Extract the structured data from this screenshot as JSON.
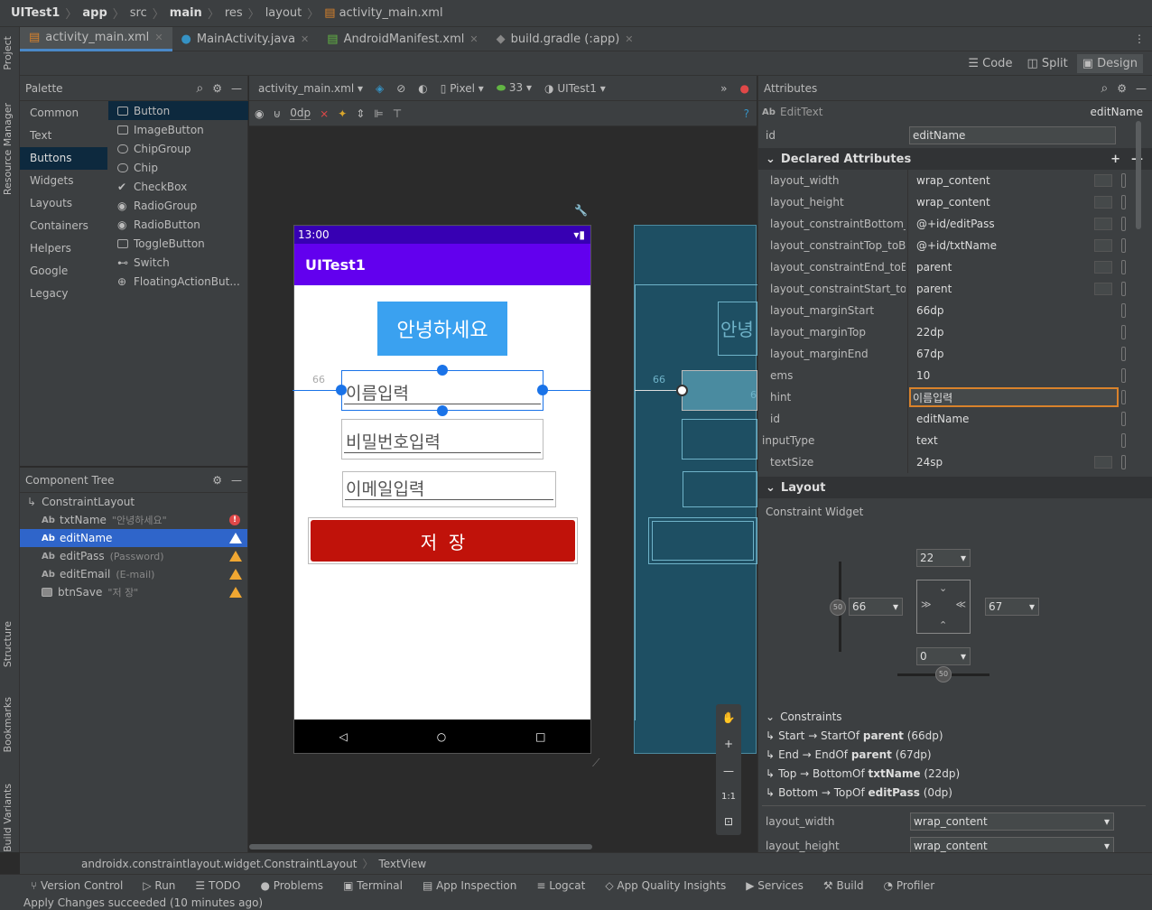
{
  "breadcrumb": [
    "UITest1",
    "app",
    "src",
    "main",
    "res",
    "layout",
    "activity_main.xml"
  ],
  "tabs": [
    {
      "label": "activity_main.xml",
      "active": true
    },
    {
      "label": "MainActivity.java",
      "active": false
    },
    {
      "label": "AndroidManifest.xml",
      "active": false
    },
    {
      "label": "build.gradle (:app)",
      "active": false
    }
  ],
  "left_strip": [
    "Project",
    "Resource Manager",
    "Structure",
    "Bookmarks",
    "Build Variants"
  ],
  "view_modes": [
    "Code",
    "Split",
    "Design"
  ],
  "palette": {
    "title": "Palette",
    "categories": [
      "Common",
      "Text",
      "Buttons",
      "Widgets",
      "Layouts",
      "Containers",
      "Helpers",
      "Google",
      "Legacy"
    ],
    "selected_category": "Buttons",
    "items": [
      "Button",
      "ImageButton",
      "ChipGroup",
      "Chip",
      "CheckBox",
      "RadioGroup",
      "RadioButton",
      "ToggleButton",
      "Switch",
      "FloatingActionBut..."
    ]
  },
  "component_tree": {
    "title": "Component Tree",
    "root": "ConstraintLayout",
    "rows": [
      {
        "name": "txtName",
        "hint": "\"안녕하세요\"",
        "tag": "Ab",
        "status": "error"
      },
      {
        "name": "editName",
        "hint": "",
        "tag": "Ab",
        "status": "warning",
        "selected": true
      },
      {
        "name": "editPass",
        "hint": "(Password)",
        "tag": "Ab",
        "status": "warning"
      },
      {
        "name": "editEmail",
        "hint": "(E-mail)",
        "tag": "Ab",
        "status": "warning"
      },
      {
        "name": "btnSave",
        "hint": "\"저  장\"",
        "tag": "",
        "status": "warning"
      }
    ]
  },
  "design_toolbar": {
    "file": "activity_main.xml",
    "device": "Pixel",
    "api": "33",
    "theme": "UITest1",
    "margin": "0dp"
  },
  "phone": {
    "time": "13:00",
    "app_title": "UITest1",
    "hello": "안녕하세요",
    "name_hint": "이름입력",
    "pass_hint": "비밀번호입력",
    "email_hint": "이메일입력",
    "save": "저  장",
    "margin_label": "66"
  },
  "blueprint": {
    "hello": "안녕",
    "margin_label": "66",
    "e": "6"
  },
  "zoom_tools": [
    "1:1"
  ],
  "attributes": {
    "title": "Attributes",
    "widget_type": "EditText",
    "widget_name": "editName",
    "id_label": "id",
    "id_value": "editName",
    "declared_title": "Declared Attributes",
    "declared": [
      {
        "name": "layout_width",
        "value": "wrap_content",
        "dropdown": true
      },
      {
        "name": "layout_height",
        "value": "wrap_content",
        "dropdown": true
      },
      {
        "name": "layout_constraintBottom_to...",
        "value": "@+id/editPass",
        "dropdown": true
      },
      {
        "name": "layout_constraintTop_toBott...",
        "value": "@+id/txtName",
        "dropdown": true
      },
      {
        "name": "layout_constraintEnd_toEnd...",
        "value": "parent",
        "dropdown": true
      },
      {
        "name": "layout_constraintStart_toSta...",
        "value": "parent",
        "dropdown": true
      },
      {
        "name": "layout_marginStart",
        "value": "66dp",
        "dropdown": false
      },
      {
        "name": "layout_marginTop",
        "value": "22dp",
        "dropdown": false
      },
      {
        "name": "layout_marginEnd",
        "value": "67dp",
        "dropdown": false
      },
      {
        "name": "ems",
        "value": "10",
        "dropdown": false
      },
      {
        "name": "hint",
        "value": "이름입력",
        "dropdown": false,
        "focused": true
      },
      {
        "name": "id",
        "value": "editName",
        "dropdown": false
      },
      {
        "name": "inputType",
        "value": "text",
        "dropdown": false
      },
      {
        "name": "textSize",
        "value": "24sp",
        "dropdown": true
      }
    ],
    "layout_title": "Layout",
    "constraint_widget": "Constraint Widget",
    "margins": {
      "top": "22",
      "start": "66",
      "end": "67",
      "bottom": "0",
      "bias_v": "50",
      "bias_h": "50"
    },
    "constraints_title": "Constraints",
    "constraints": [
      {
        "pre": "Start → StartOf ",
        "target": "parent",
        "post": " (66dp)"
      },
      {
        "pre": "End → EndOf ",
        "target": "parent",
        "post": " (67dp)"
      },
      {
        "pre": "Top → BottomOf ",
        "target": "txtName",
        "post": " (22dp)"
      },
      {
        "pre": "Bottom → TopOf ",
        "target": "editPass",
        "post": " (0dp)"
      }
    ],
    "bottom_rows": [
      {
        "name": "layout_width",
        "value": "wrap_content"
      },
      {
        "name": "layout_height",
        "value": "wrap_content"
      }
    ]
  },
  "path_bar": [
    "androidx.constraintlayout.widget.ConstraintLayout",
    "TextView"
  ],
  "bottom_tools": [
    "Version Control",
    "Run",
    "TODO",
    "Problems",
    "Terminal",
    "App Inspection",
    "Logcat",
    "App Quality Insights",
    "Services",
    "Build",
    "Profiler"
  ],
  "status": "Apply Changes succeeded (10 minutes ago)"
}
